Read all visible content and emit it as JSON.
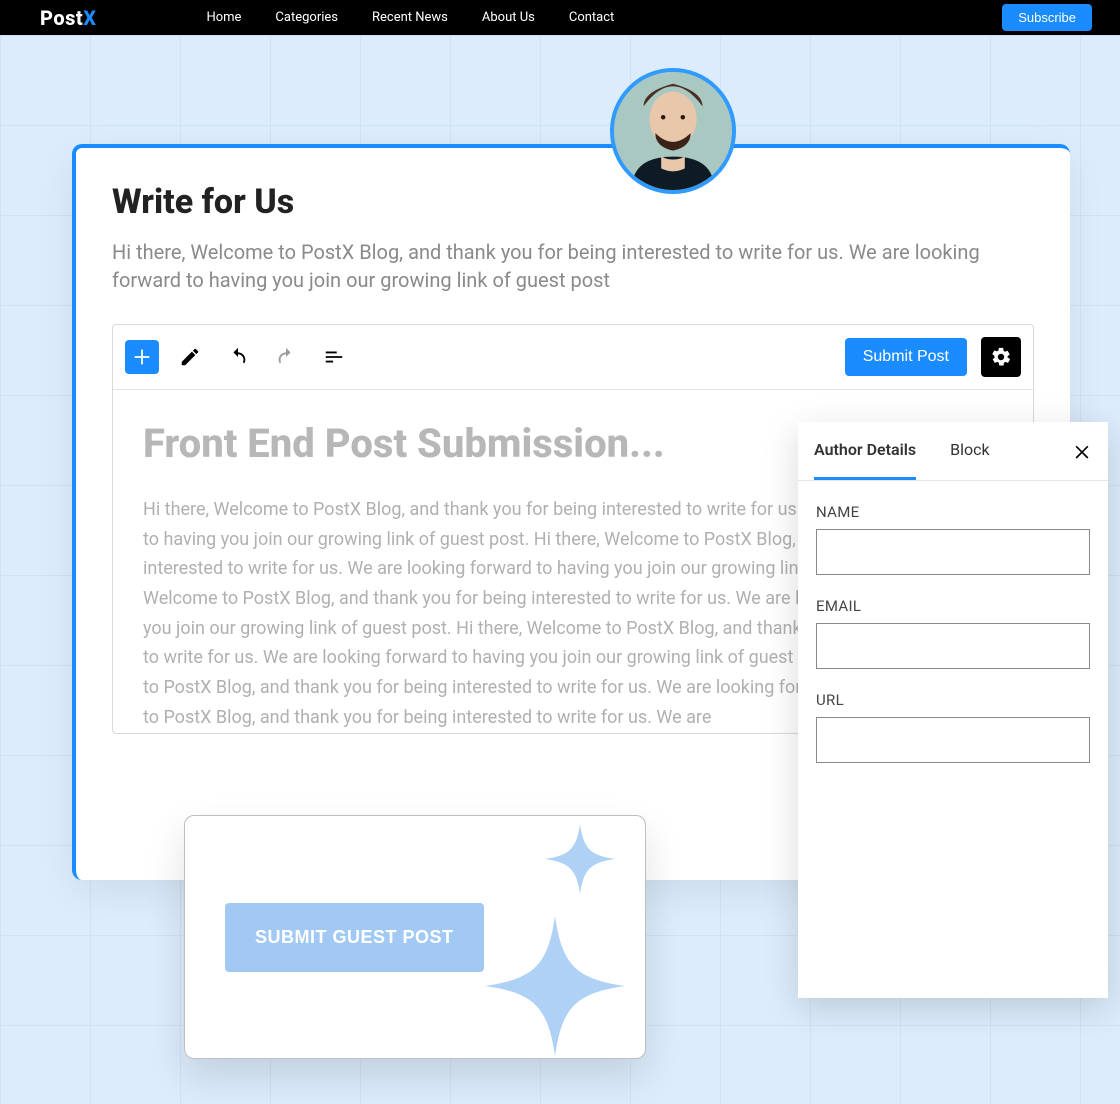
{
  "brand": {
    "name": "Post",
    "suffix": "X"
  },
  "nav": {
    "items": [
      "Home",
      "Categories",
      "Recent News",
      "About Us",
      "Contact"
    ],
    "subscribe": "Subscribe"
  },
  "page": {
    "title": "Write for Us",
    "lead": "Hi there, Welcome to PostX Blog, and thank you for being interested to write for us. We are looking forward to having you join our growing link of guest post"
  },
  "editor": {
    "submit": "Submit Post",
    "title_placeholder": "Front End Post Submission...",
    "body_text": "Hi there, Welcome to PostX Blog, and thank you for being interested to write for us. We are looking forward to having you join our growing link of guest post. Hi there, Welcome to PostX Blog, and thank you for being interested to write for us. We are looking forward to having you join our growing link of guest post. Hi there, Welcome to PostX Blog, and thank you for being interested to write for us. We are looking forward to having you join our growing link of guest post. Hi there, Welcome to PostX Blog, and thank you for being interested to write for us. We are looking forward to having you join our growing link of guest post. Hi there, Welcome to PostX Blog, and thank you for being interested to write for us. We are looking forward. Hi there, Welcome to PostX Blog, and thank you for being interested to write for us. We are"
  },
  "sidepanel": {
    "tabs": {
      "author": "Author Details",
      "block": "Block"
    },
    "fields": {
      "name": "NAME",
      "email": "EMAIL",
      "url": "URL"
    },
    "values": {
      "name": "",
      "email": "",
      "url": ""
    }
  },
  "cta": {
    "label": "SUBMIT GUEST POST"
  }
}
